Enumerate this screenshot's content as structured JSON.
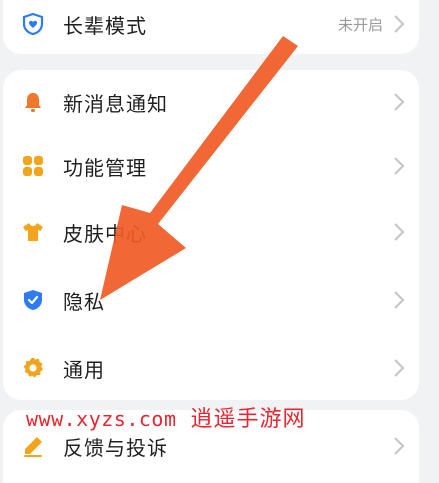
{
  "settings": {
    "elder_mode": {
      "label": "长辈模式",
      "value": "未开启",
      "icon": "heart-shield-icon",
      "color": "#2f7bf5"
    },
    "main_items": [
      {
        "label": "新消息通知",
        "icon": "bell-icon",
        "color": "#f2762c"
      },
      {
        "label": "功能管理",
        "icon": "grid-icon",
        "color": "#f2a51c"
      },
      {
        "label": "皮肤中心",
        "icon": "tshirt-icon",
        "color": "#f2a51c"
      },
      {
        "label": "隐私",
        "icon": "shield-check-icon",
        "color": "#2f7bf5"
      },
      {
        "label": "通用",
        "icon": "gear-icon",
        "color": "#f2a51c"
      }
    ],
    "feedback": {
      "label": "反馈与投诉",
      "icon": "pencil-icon",
      "color": "#f2a51c"
    }
  },
  "watermark": {
    "url": "www.xyzs.com",
    "brand": "逍遥手游网",
    "color": "#e8262f"
  },
  "annotation": {
    "arrow_color": "#f05a24"
  }
}
